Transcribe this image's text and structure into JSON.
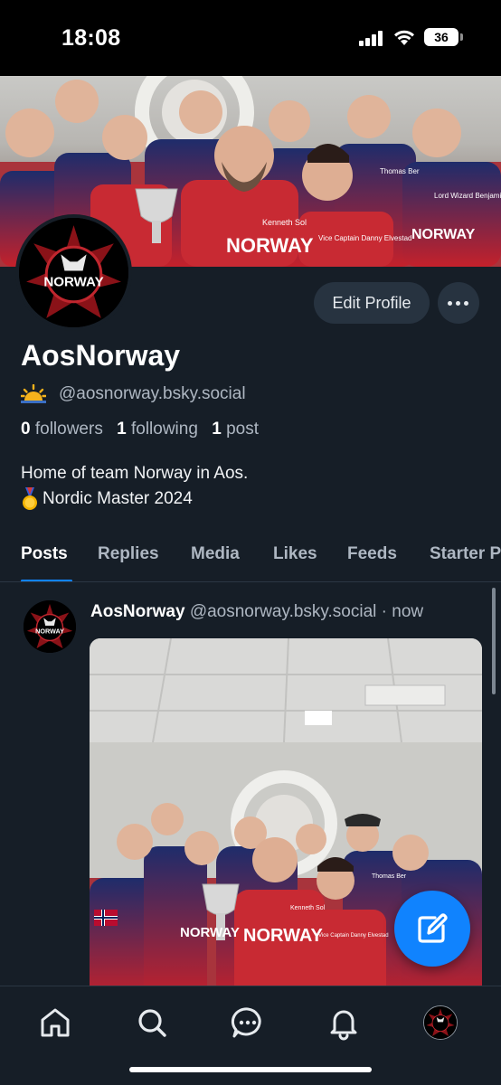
{
  "status_bar": {
    "time": "18:08",
    "battery": "36"
  },
  "profile": {
    "display_name": "AosNorway",
    "handle": "@aosnorway.bsky.social",
    "edit_button": "Edit Profile",
    "followers_count": "0",
    "followers_label": "followers",
    "following_count": "1",
    "following_label": "following",
    "posts_count": "1",
    "posts_label": "post",
    "bio_line1": "Home of team Norway in Aos.",
    "bio_line2": "Nordic Master 2024"
  },
  "tabs": [
    "Posts",
    "Replies",
    "Media",
    "Likes",
    "Feeds",
    "Starter Packs"
  ],
  "active_tab": "Posts",
  "post": {
    "author_name": "AosNorway",
    "author_handle": "@aosnorway.bsky.social",
    "time": "· now"
  },
  "photo_text": {
    "logo": "NORWAY",
    "jersey_1": "NORWAY",
    "jersey_2": "Kenneth Sol",
    "jersey_3": "Vice Captain Danny Elvestad",
    "jersey_4": "Thomas Ber",
    "jersey_5": "Lord Wizard Benjamin Rodin",
    "jersey_6": "Elvestad"
  },
  "nav": [
    "home-icon",
    "search-icon",
    "chat-icon",
    "bell-icon",
    "profile-avatar"
  ],
  "colors": {
    "background": "#161e27",
    "accent": "#1083fe",
    "muted": "#aeb7c2",
    "button_bg": "#273340"
  }
}
